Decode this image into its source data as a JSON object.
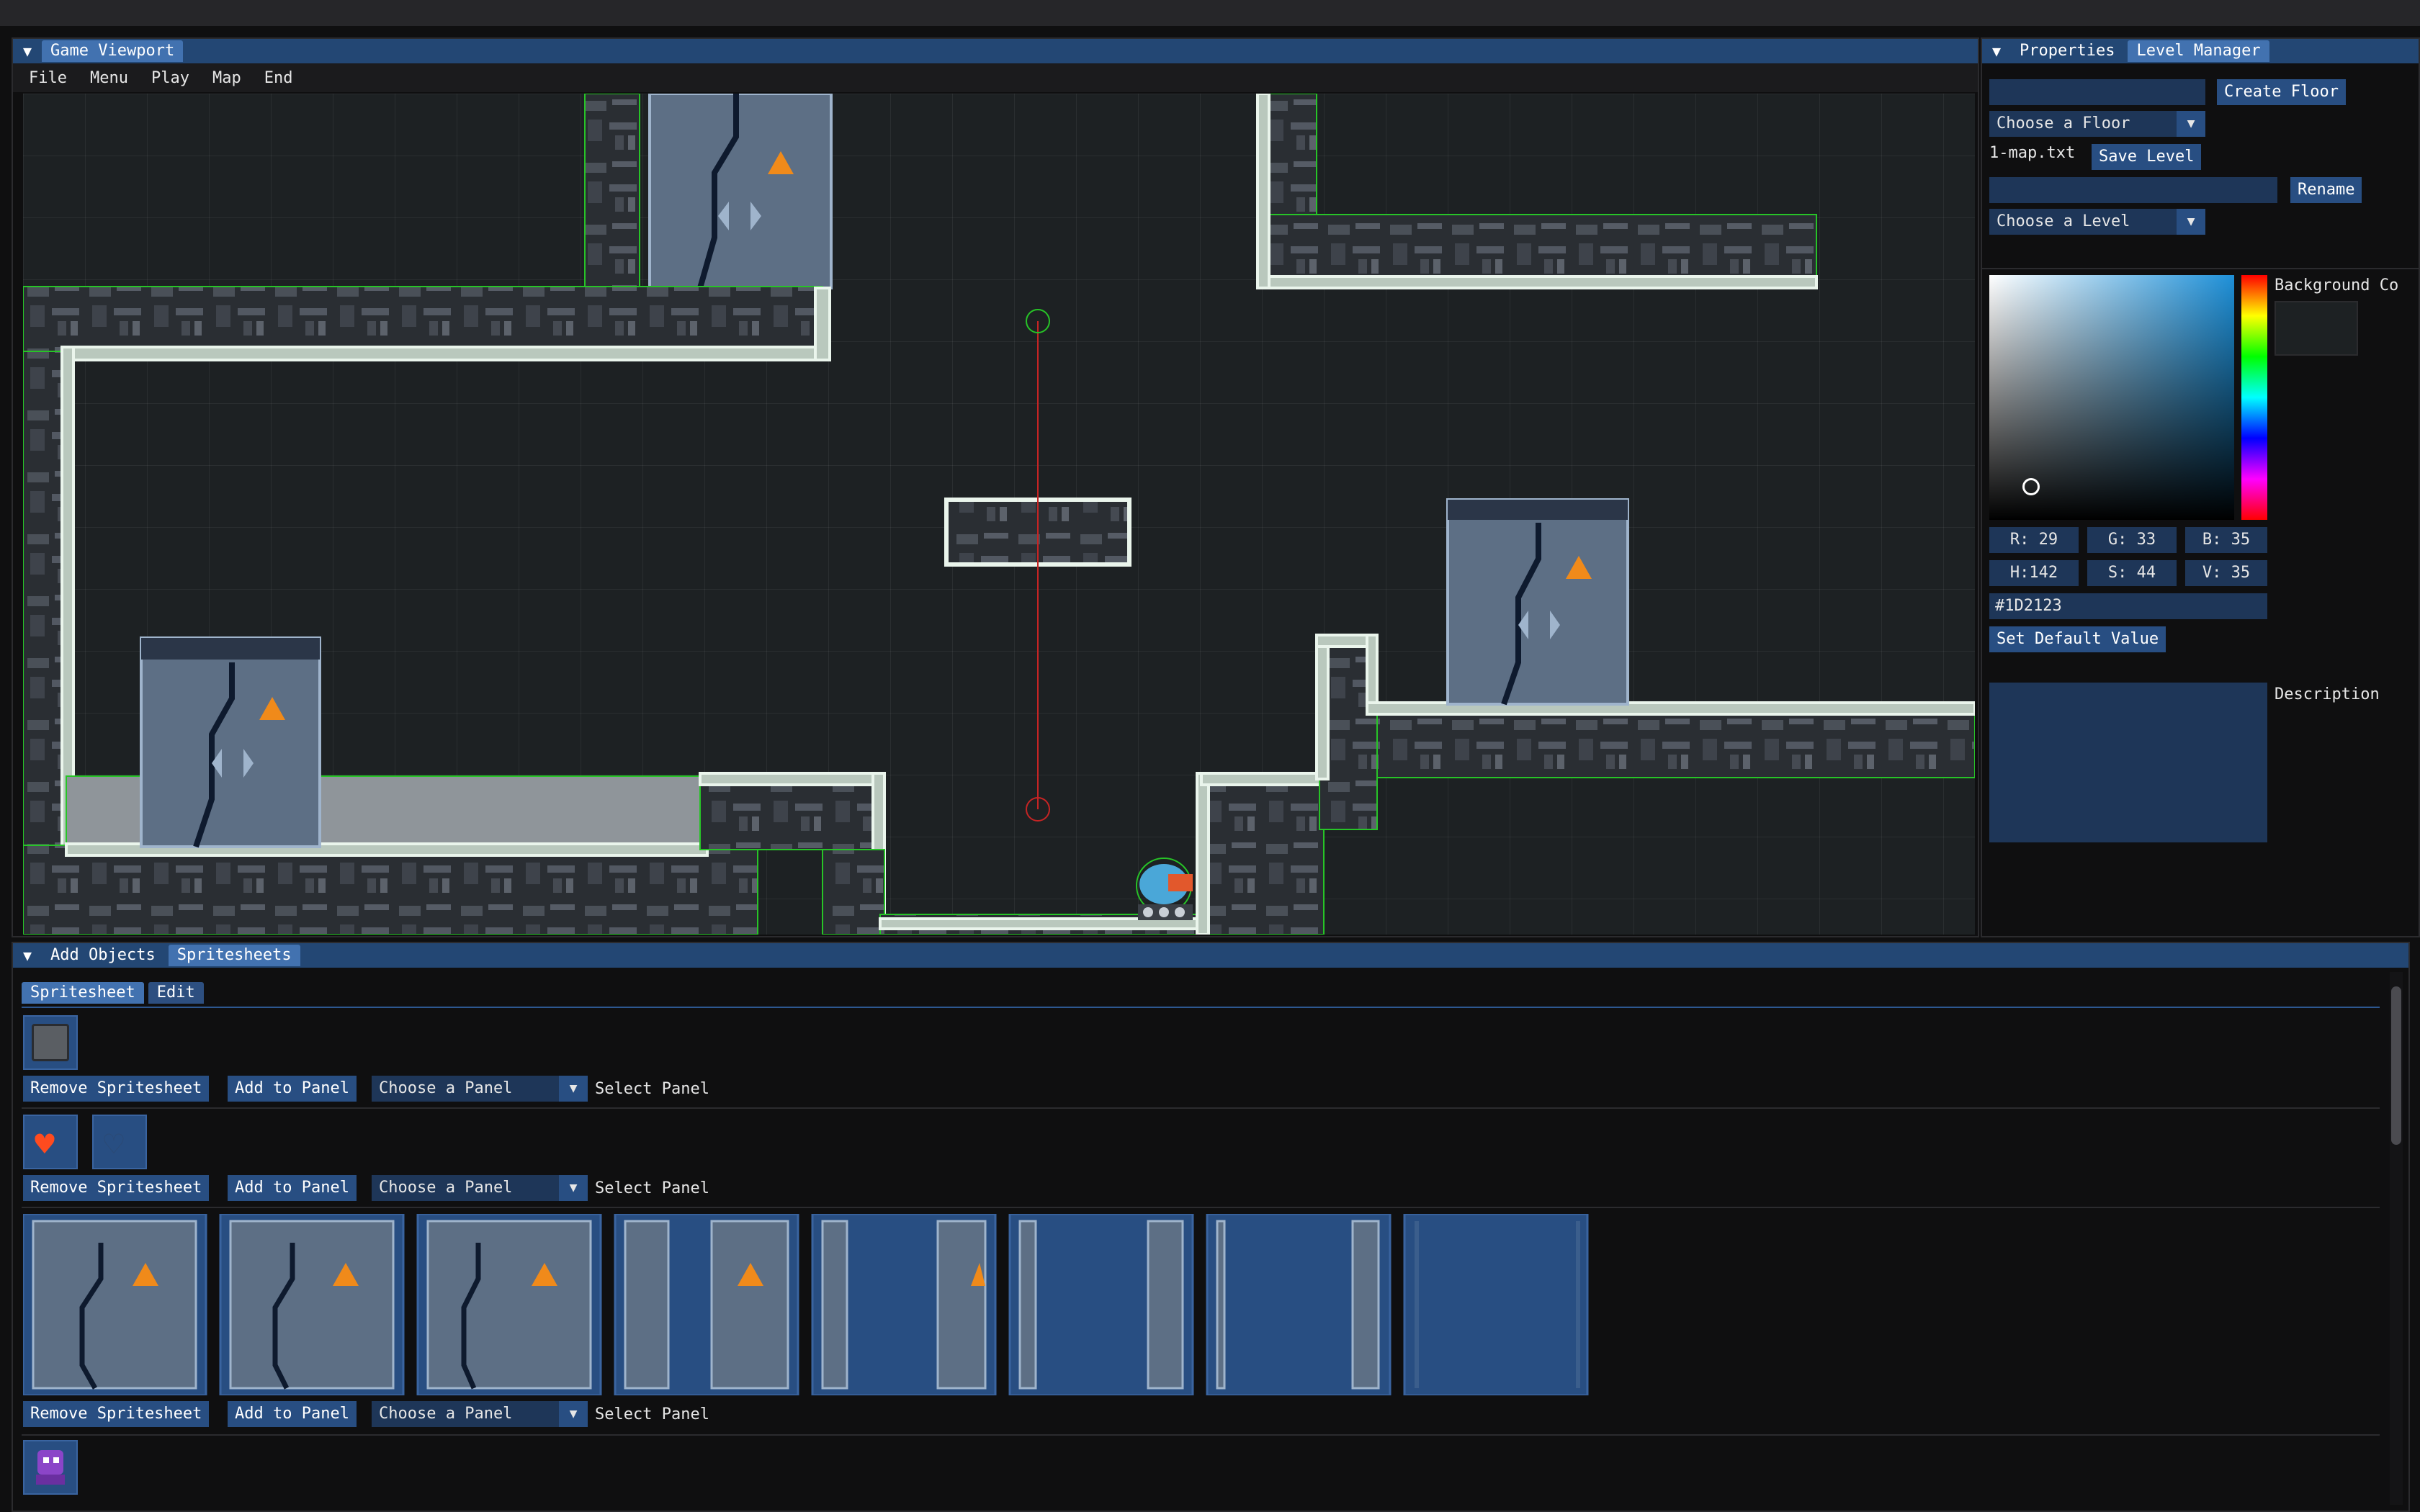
{
  "viewport": {
    "title": "Game Viewport",
    "menu": [
      "File",
      "Menu",
      "Play",
      "Map",
      "End"
    ]
  },
  "props": {
    "tabs": [
      "Properties",
      "Level Manager"
    ],
    "create_floor": "Create Floor",
    "choose_floor": "Choose a Floor",
    "map_file": "1-map.txt",
    "save_level": "Save Level",
    "rename": "Rename",
    "choose_level": "Choose a Level",
    "background_label": "Background Co",
    "rgb": {
      "r": "R: 29",
      "g": "G: 33",
      "b": "B: 35"
    },
    "hsv": {
      "h": "H:142",
      "s": "S: 44",
      "v": "V: 35"
    },
    "hex": "#1D2123",
    "set_default": "Set Default Value",
    "description_label": "Description",
    "colors": {
      "background": "#1D2123"
    }
  },
  "bottom": {
    "tabs": [
      "Add Objects",
      "Spritesheets"
    ],
    "subtabs": [
      "Spritesheet",
      "Edit"
    ],
    "remove_label": "Remove Spritesheet",
    "add_label": "Add to Panel",
    "choose_panel": "Choose a Panel",
    "select_panel": "Select Panel"
  }
}
